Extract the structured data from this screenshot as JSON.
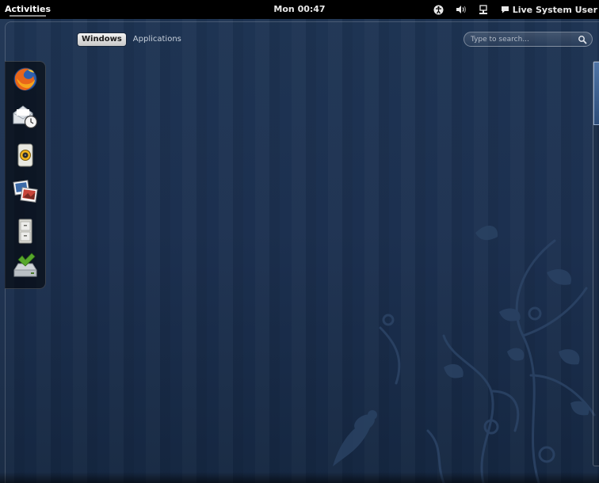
{
  "top_panel": {
    "activities_label": "Activities",
    "clock": "Mon 00:47",
    "status_icons": [
      "accessibility-icon",
      "volume-icon",
      "network-icon"
    ],
    "user_name": "Live System User"
  },
  "overview": {
    "tabs": [
      {
        "label": "Windows",
        "active": true
      },
      {
        "label": "Applications",
        "active": false
      }
    ],
    "search": {
      "placeholder": "Type to search..."
    }
  },
  "dash": {
    "items": [
      {
        "name": "firefox-icon"
      },
      {
        "name": "evolution-mail-icon"
      },
      {
        "name": "rhythmbox-speaker-icon"
      },
      {
        "name": "shotwell-photos-icon"
      },
      {
        "name": "files-cabinet-icon"
      },
      {
        "name": "install-to-hard-drive-icon"
      }
    ]
  },
  "colors": {
    "panel": "#000000",
    "wallpaper_top": "#1e3453",
    "wallpaper_bottom": "#152741",
    "accent": "#4f74a5"
  }
}
